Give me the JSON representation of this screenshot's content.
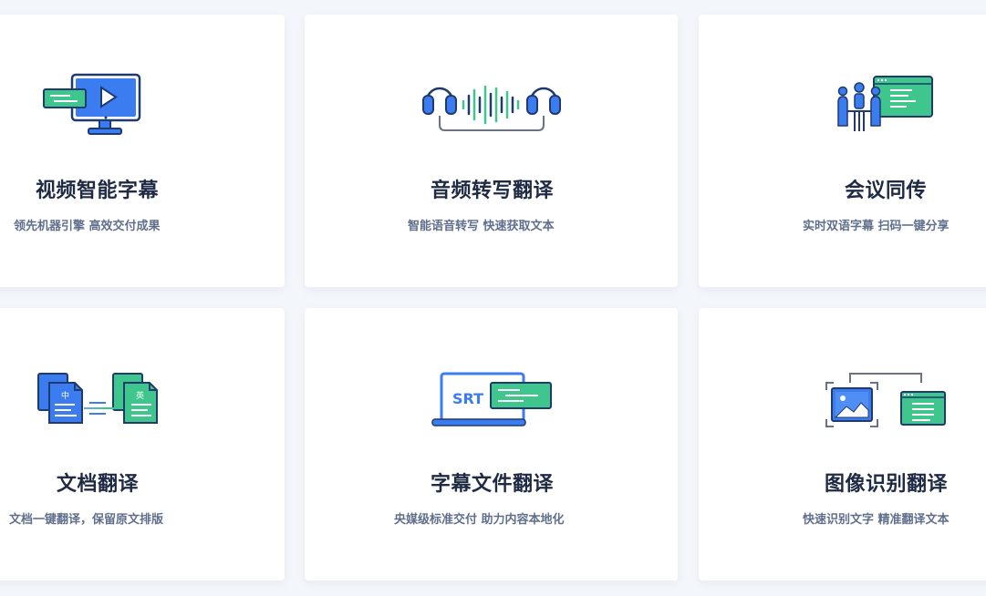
{
  "colors": {
    "blue": "#3b7cf0",
    "green": "#3ec68c",
    "navy": "#1f3a6e",
    "title": "#1f2a44",
    "subtitle": "#5f6f8c"
  },
  "services": [
    {
      "title": "视频智能字幕",
      "subtitle": "领先机器引擎 高效交付成果",
      "icon": "video-monitor-icon"
    },
    {
      "title": "音频转写翻译",
      "subtitle": "智能语音转写 快速获取文本",
      "icon": "headphones-waveform-icon"
    },
    {
      "title": "会议同传",
      "subtitle": "实时双语字幕 扫码一键分享",
      "icon": "meeting-presentation-icon"
    },
    {
      "title": "文档翻译",
      "subtitle": "文档一键翻译，保留原文排版",
      "icon": "document-translate-icon",
      "icon_text": {
        "zh": "中",
        "en": "英"
      }
    },
    {
      "title": "字幕文件翻译",
      "subtitle": "央媒级标准交付 助力内容本地化",
      "icon": "srt-laptop-icon",
      "icon_text": {
        "srt": "SRT"
      }
    },
    {
      "title": "图像识别翻译",
      "subtitle": "快速识别文字 精准翻译文本",
      "icon": "image-recognition-icon"
    }
  ]
}
